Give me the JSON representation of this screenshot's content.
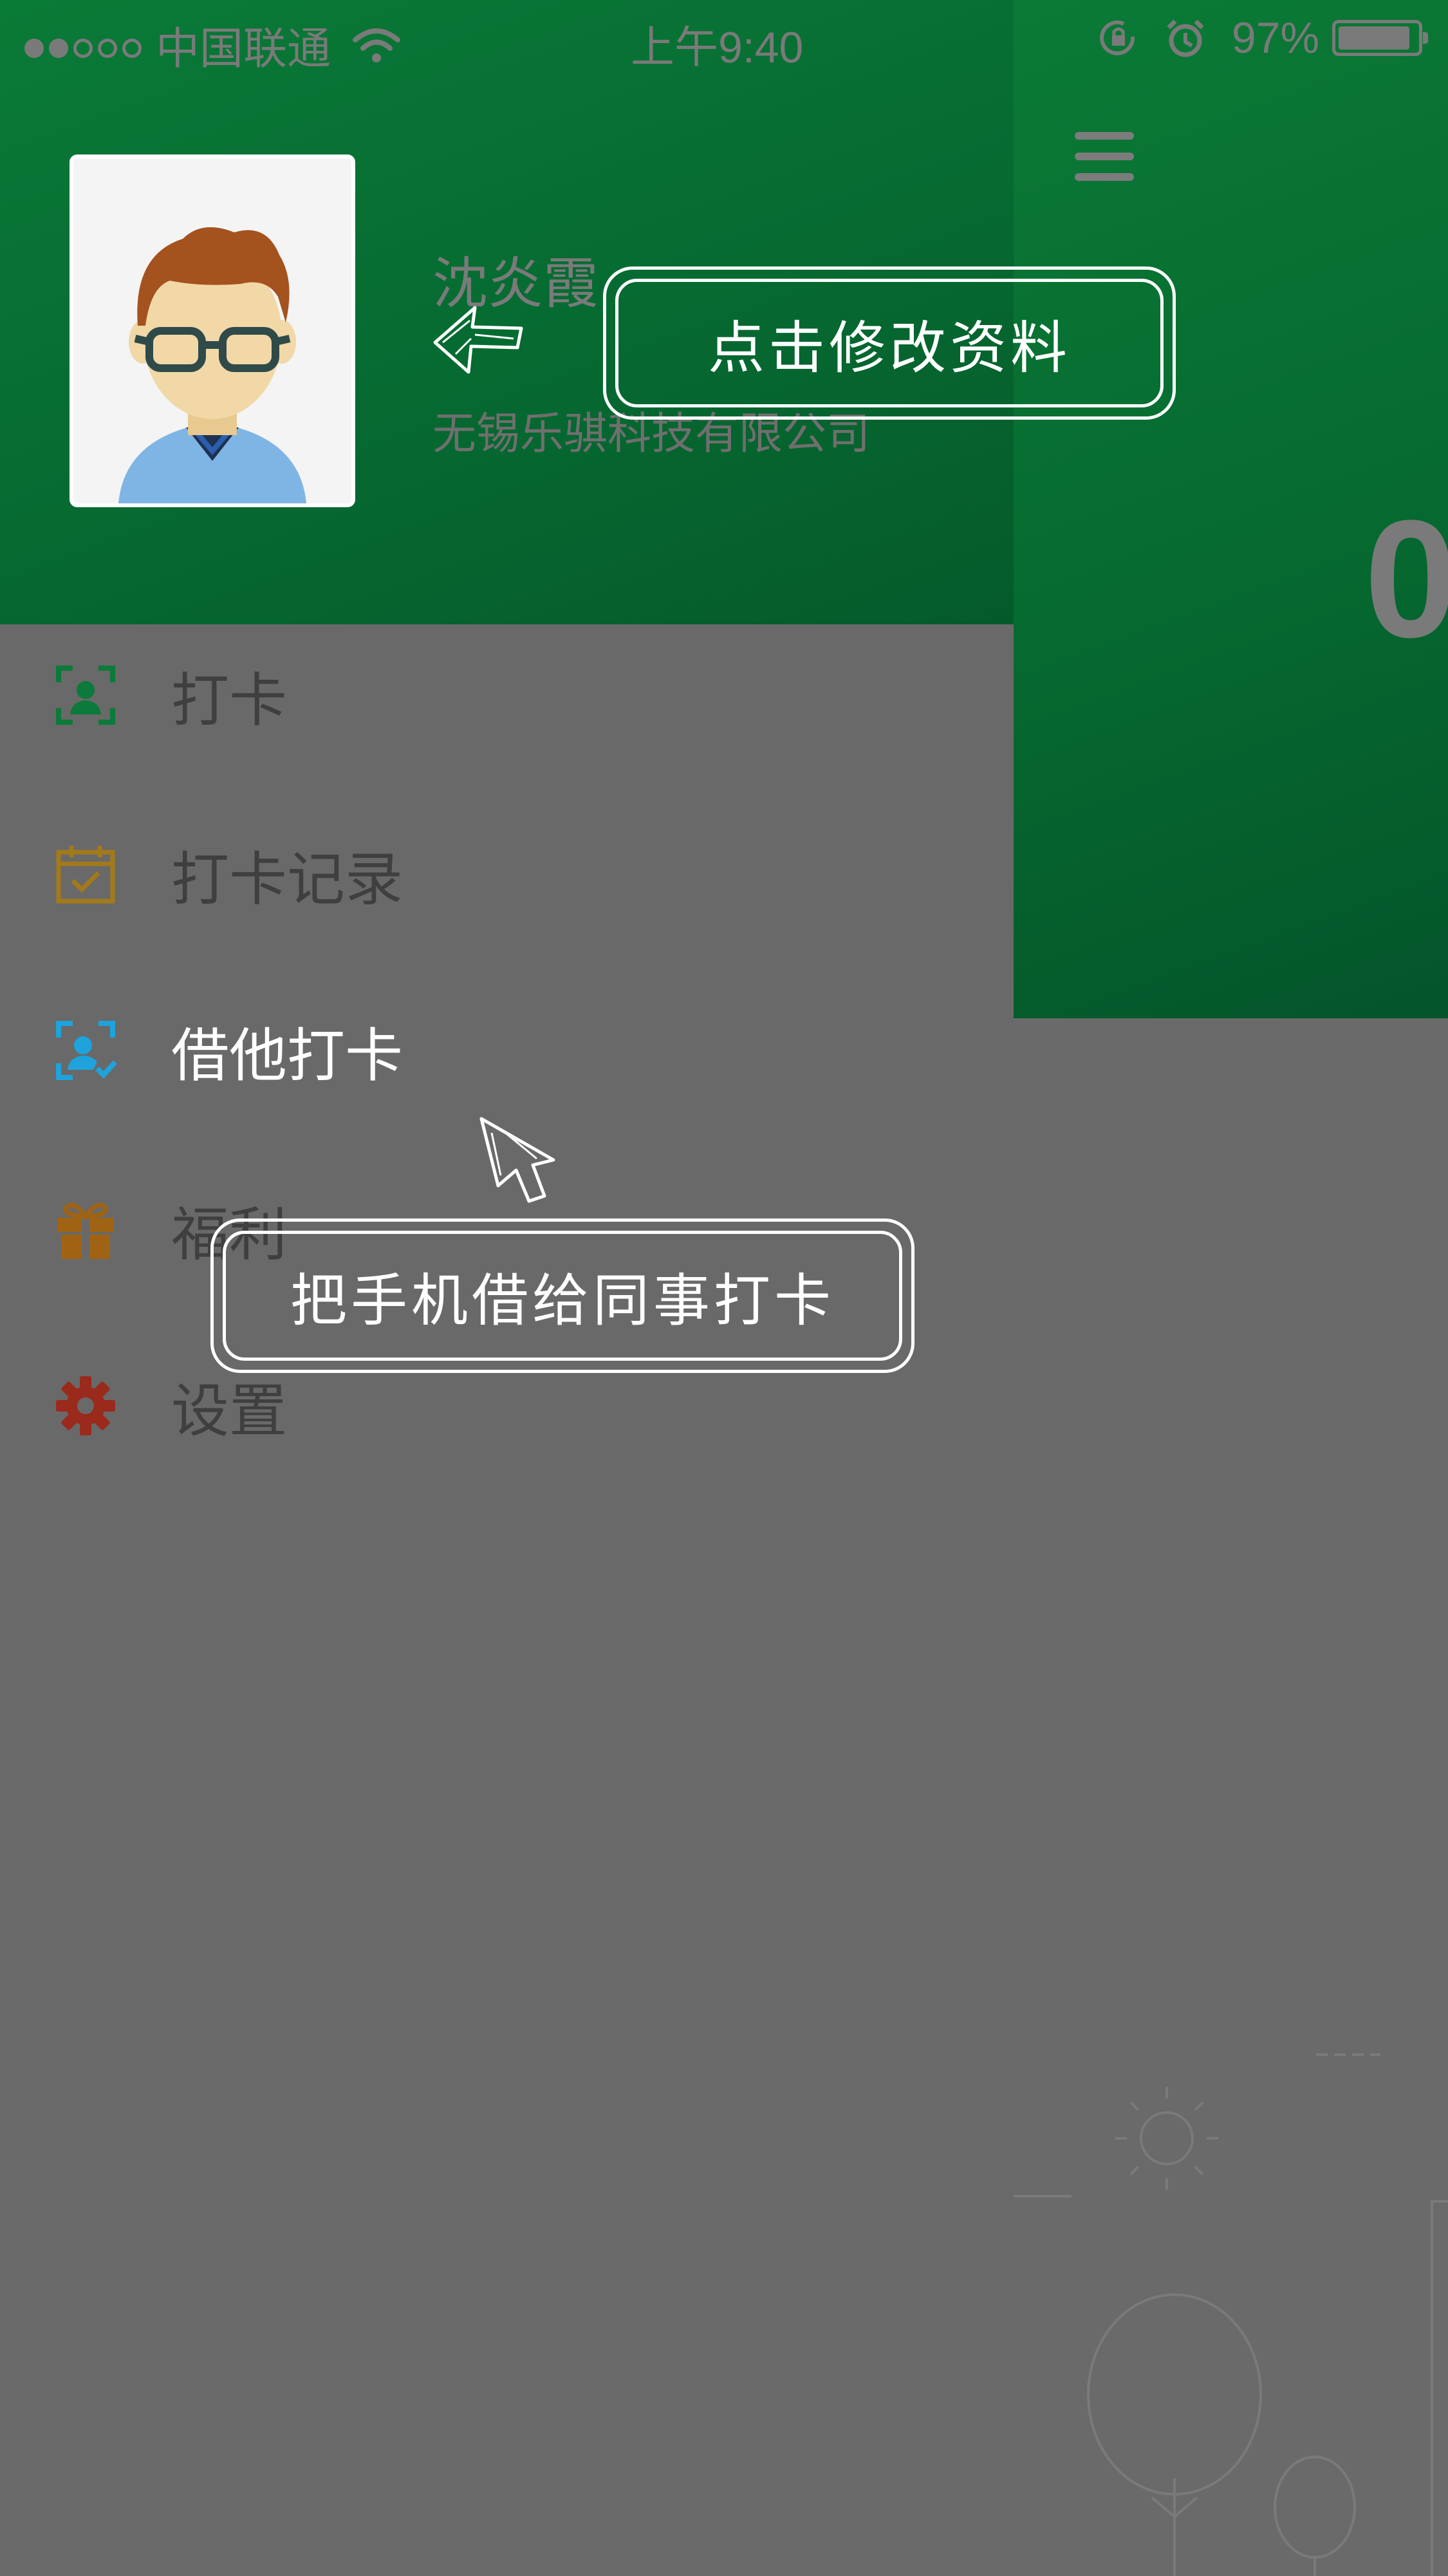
{
  "status_bar": {
    "carrier": "中国联通",
    "time": "上午9:40",
    "battery": "97%",
    "signal_bars_filled": 2,
    "signal_bars_total": 5
  },
  "main": {
    "big_number": "0"
  },
  "drawer": {
    "user_name": "沈炎霞",
    "company": "无锡乐骐科技有限公司",
    "menu": [
      {
        "label": "打卡",
        "icon": "face-scan-icon",
        "color": "#0b7a3a"
      },
      {
        "label": "打卡记录",
        "icon": "calendar-check-icon",
        "color": "#a37a1a"
      },
      {
        "label": "借他打卡",
        "icon": "face-scan-check-icon",
        "color": "#1ea3dc"
      },
      {
        "label": "福利",
        "icon": "gift-icon",
        "color": "#a06314"
      },
      {
        "label": "设置",
        "icon": "gear-icon",
        "color": "#9a2a1c"
      }
    ]
  },
  "tutorial": {
    "edit_profile_tip": "点击修改资料",
    "lend_phone_tip": "把手机借给同事打卡"
  }
}
